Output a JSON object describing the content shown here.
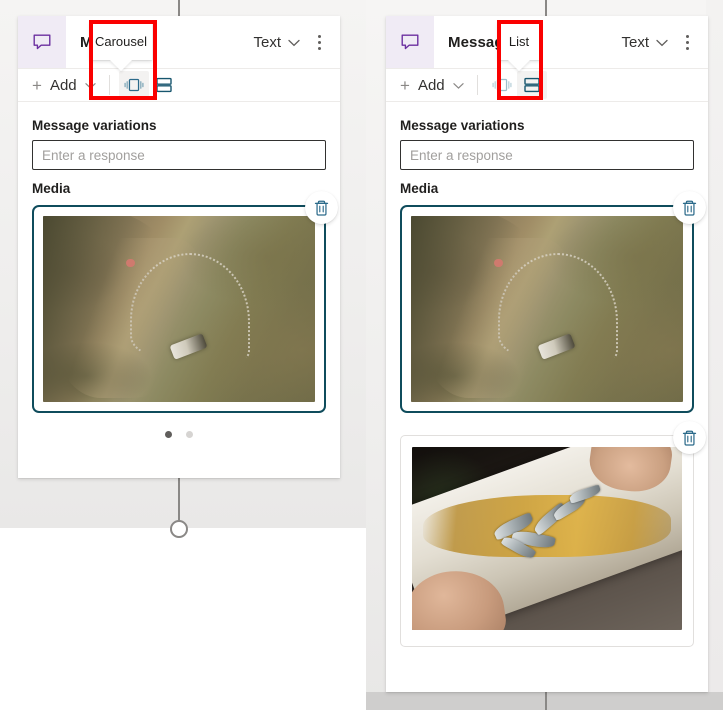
{
  "canvas": {
    "background_color": "#f2f1f0",
    "connector_color": "#8a8886"
  },
  "panels": [
    {
      "id": "carousel-panel",
      "header": {
        "icon": "message-bubble-icon",
        "icon_color": "#6b2fa0",
        "title": "Message",
        "mode_label": "Text",
        "mode_caret": "chevron-down-icon",
        "overflow": "kebab-menu-icon"
      },
      "toolbar": {
        "add_label": "Add",
        "add_plus": "plus-icon",
        "add_caret": "chevron-down-icon",
        "buttons": [
          {
            "name": "carousel-layout-icon",
            "label": "Carousel",
            "selected": true
          },
          {
            "name": "list-layout-icon",
            "label": "List",
            "selected": false
          }
        ]
      },
      "tooltip": {
        "text": "Carousel"
      },
      "body": {
        "variations_label": "Message variations",
        "variations_value": "",
        "variations_placeholder": "Enter a response",
        "media_label": "Media",
        "media_items": [
          {
            "alt": "Aerial photo of a fishing boat trailing a long net along a muddy shoreline",
            "delete_icon": "trash-icon",
            "delete_icon_color": "#2b6a8a",
            "border_color": "#0f4c5c",
            "selected": true
          }
        ],
        "carousel_dots": {
          "count": 2,
          "active_index": 0
        }
      }
    },
    {
      "id": "list-panel",
      "header": {
        "icon": "message-bubble-icon",
        "icon_color": "#6b2fa0",
        "title": "Message",
        "mode_label": "Text",
        "mode_caret": "chevron-down-icon",
        "overflow": "kebab-menu-icon"
      },
      "toolbar": {
        "add_label": "Add",
        "add_plus": "plus-icon",
        "add_caret": "chevron-down-icon",
        "buttons": [
          {
            "name": "carousel-layout-icon",
            "label": "Carousel",
            "selected": false
          },
          {
            "name": "list-layout-icon",
            "label": "List",
            "selected": true
          }
        ]
      },
      "tooltip": {
        "text": "List"
      },
      "body": {
        "variations_label": "Message variations",
        "variations_value": "",
        "variations_placeholder": "Enter a response",
        "media_label": "Media",
        "media_items": [
          {
            "alt": "Aerial photo of a fishing boat trailing a long net along a muddy shoreline",
            "delete_icon": "trash-icon",
            "delete_icon_color": "#2b6a8a",
            "border_color": "#0f4c5c",
            "selected": true
          },
          {
            "alt": "Hands holding a white trough filled with small silver fish and amber brine",
            "delete_icon": "trash-icon",
            "delete_icon_color": "#2b6a8a",
            "border_color": "#e1dfdd",
            "selected": false
          }
        ]
      }
    }
  ],
  "annotations": {
    "highlight_color": "#fa0000",
    "boxes": [
      {
        "target": "carousel-tooltip-and-button"
      },
      {
        "target": "list-tooltip-and-button"
      }
    ]
  }
}
